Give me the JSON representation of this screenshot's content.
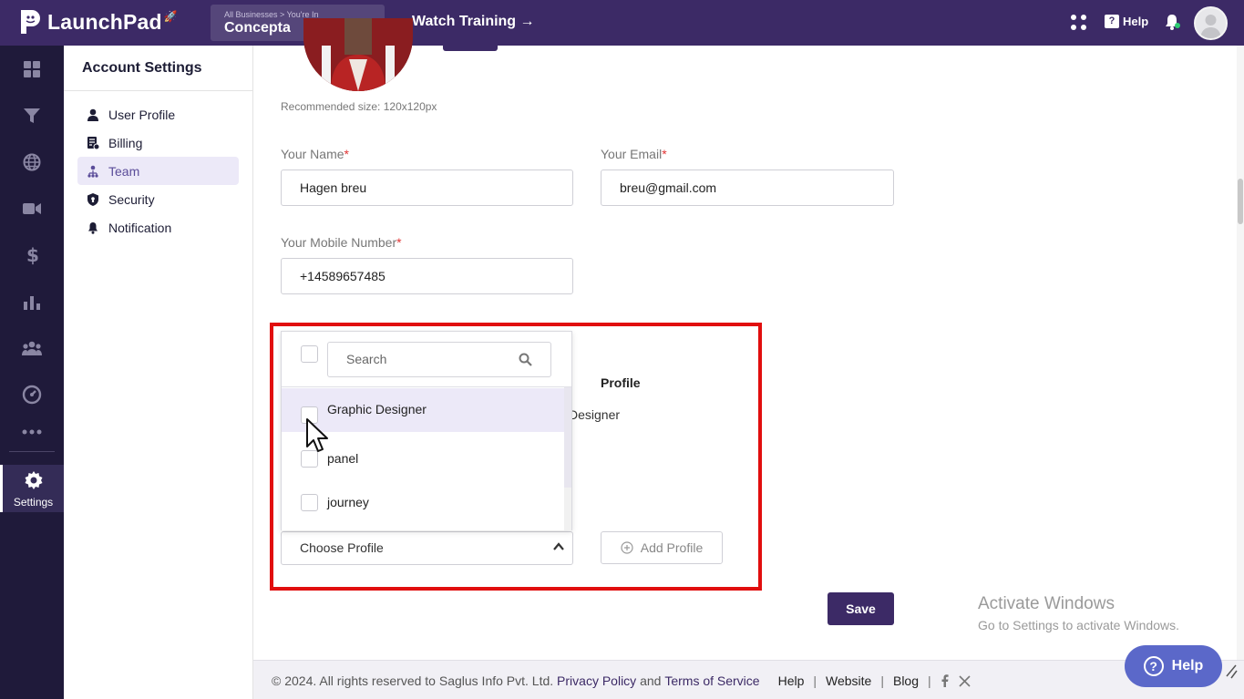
{
  "app": {
    "logo_text": "LaunchPad",
    "business_crumb": "All Businesses > You're In",
    "business_name": "Concepta",
    "watch_training": "Watch Training →",
    "help_label": "Help"
  },
  "rail": {
    "settings_label": "Settings"
  },
  "settings_nav": {
    "title": "Account Settings",
    "items": [
      {
        "label": "User Profile"
      },
      {
        "label": "Billing"
      },
      {
        "label": "Team"
      },
      {
        "label": "Security"
      },
      {
        "label": "Notification"
      }
    ]
  },
  "form": {
    "recommended": "Recommended size: 120x120px",
    "name_label": "Your Name",
    "name_value": "Hagen breu",
    "email_label": "Your Email",
    "email_value": "breu@gmail.com",
    "mobile_label": "Your Mobile Number",
    "mobile_value": "+14589657485",
    "required_mark": "*",
    "profile_header": "Profile",
    "profile_cell": "Designer",
    "choose_profile": "Choose Profile",
    "add_profile": "Add Profile",
    "save": "Save"
  },
  "dropdown": {
    "search_placeholder": "Search",
    "options": [
      {
        "label": "Graphic Designer"
      },
      {
        "label": "panel"
      },
      {
        "label": "journey"
      }
    ]
  },
  "footer": {
    "copyright": "© 2024. All rights reserved to Saglus Info Pvt. Ltd.",
    "privacy": "Privacy Policy",
    "and": "and",
    "terms": "Terms of Service",
    "help": "Help",
    "website": "Website",
    "blog": "Blog",
    "separator": "|"
  },
  "overlay": {
    "activate_title": "Activate Windows",
    "activate_sub": "Go to Settings to activate Windows.",
    "help_fab": "Help",
    "help_fab_icon": "?"
  }
}
